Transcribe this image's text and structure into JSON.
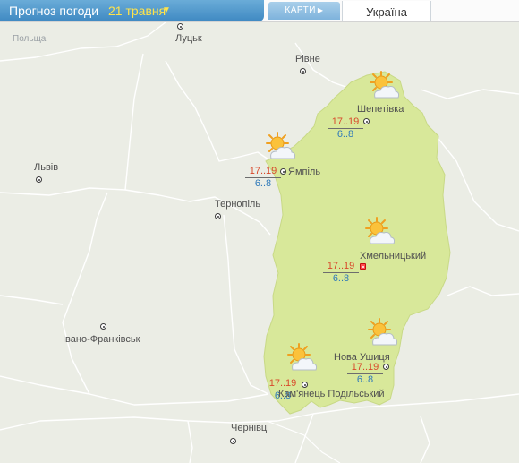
{
  "header": {
    "title": "Прогноз погоди",
    "date": "21 травня",
    "maps_button": "КАРТИ",
    "region_tab": "Україна"
  },
  "countries": [
    {
      "name": "Польща"
    }
  ],
  "cities": [
    {
      "name": "Луцьк"
    },
    {
      "name": "Рівне"
    },
    {
      "name": "Львів"
    },
    {
      "name": "Тернопіль"
    },
    {
      "name": "Івано-Франківськ"
    },
    {
      "name": "Чернівці"
    }
  ],
  "forecast_points": [
    {
      "name": "Шепетівка",
      "day": "17..19",
      "night": "6..8",
      "icon": "partly-cloudy-sun-icon"
    },
    {
      "name": "Ямпіль",
      "day": "17..19",
      "night": "6..8",
      "icon": "partly-cloudy-sun-icon"
    },
    {
      "name": "Хмельницький",
      "day": "17..19",
      "night": "6..8",
      "icon": "partly-cloudy-sun-icon",
      "regional_center": true
    },
    {
      "name": "Нова Ушиця",
      "day": "17..19",
      "night": "6..8",
      "icon": "partly-cloudy-sun-icon"
    },
    {
      "name": "Кам'янець Подільський",
      "day": "17..19",
      "night": "6..8",
      "icon": "partly-cloudy-sun-icon"
    }
  ],
  "colors": {
    "highlight_region": "#d8e89a",
    "background": "#ebede5",
    "borders": "#ffffff",
    "header_blue": "#4a93c9",
    "date_yellow": "#ffe34a",
    "day_temp": "#d8492b",
    "night_temp": "#2e79b9"
  }
}
